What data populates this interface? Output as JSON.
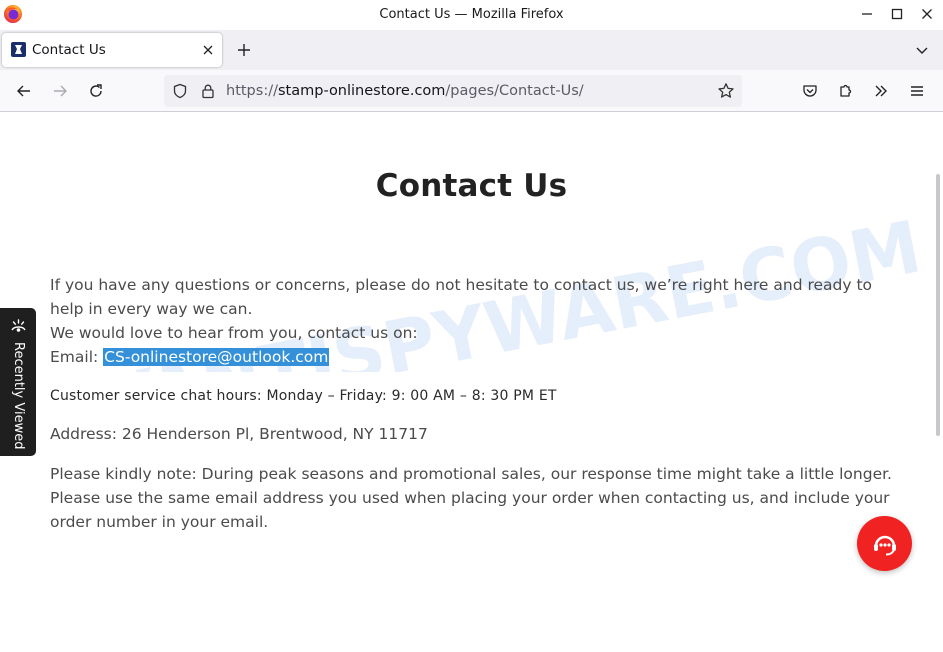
{
  "window": {
    "title": "Contact Us — Mozilla Firefox"
  },
  "tabs": [
    {
      "label": "Contact Us",
      "active": true
    }
  ],
  "urlbar": {
    "scheme": "https://",
    "domain": "stamp-onlinestore.com",
    "path": "/pages/Contact-Us/"
  },
  "page": {
    "title": "Contact Us",
    "intro_line1": "If you have any questions or concerns, please do not hesitate to contact us, we’re right here and ready to help in every way we can.",
    "intro_line2": "We would love to hear from you, contact us on:",
    "email_label": "Email: ",
    "email_value": "CS-onlinestore@outlook.com",
    "chat_hours": "Customer service chat hours: Monday – Friday: 9: 00 AM – 8: 30 PM ET",
    "address": "Address: 26 Henderson Pl, Brentwood, NY 11717",
    "note": "Please kindly note: During peak seasons and promotional sales, our response time might take a little longer. Please use the same email address you used when placing your order when contacting us, and include your order number in your email."
  },
  "side_tab": {
    "label": "Recently Viewed"
  },
  "watermark": {
    "text": "MYANTISPYWARE.COM"
  },
  "colors": {
    "chat_button": "#f02222",
    "email_highlight": "#3390d9",
    "side_tab_bg": "#1f1f1f"
  },
  "icons": {
    "back": "arrow-left-icon",
    "forward": "arrow-right-icon",
    "reload": "reload-icon",
    "shield": "shield-icon",
    "lock": "lock-icon",
    "bookmark": "star-icon",
    "pocket": "pocket-icon",
    "extensions": "puzzle-icon",
    "overflow": "chevrons-right-icon",
    "menu": "hamburger-icon",
    "chat": "headset-icon"
  }
}
